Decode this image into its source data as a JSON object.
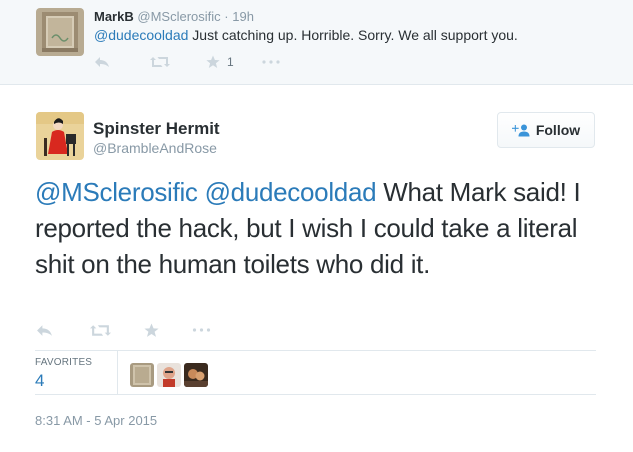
{
  "reply_tweet": {
    "name": "MarkB",
    "handle": "@MSclerosific",
    "separator": "·",
    "time": "19h",
    "mention": "@dudecooldad",
    "text": " Just catching up. Horrible. Sorry. We all support you.",
    "favorite_count": "1",
    "icons": [
      "reply-icon",
      "retweet-icon",
      "star-icon",
      "more-icon"
    ]
  },
  "main_tweet": {
    "name": "Spinster Hermit",
    "handle": "@BrambleAndRose",
    "follow_label": "Follow",
    "mention1": "@MSclerosific",
    "mention2": "@dudecooldad",
    "text": " What Mark said! I reported the hack, but I wish I could take a literal shit on the human toilets who did it.",
    "favorites_label": "FAVORITES",
    "favorites_count": "4",
    "timestamp": "8:31 AM - 5 Apr 2015",
    "icons": [
      "reply-icon",
      "retweet-icon",
      "star-icon",
      "more-icon",
      "follow-person-icon"
    ]
  },
  "colors": {
    "link": "#2b7bb9",
    "muted": "#8899a6",
    "icon": "#ccd6dd",
    "text": "#292f33",
    "reply_bg": "#f5f8fa"
  }
}
